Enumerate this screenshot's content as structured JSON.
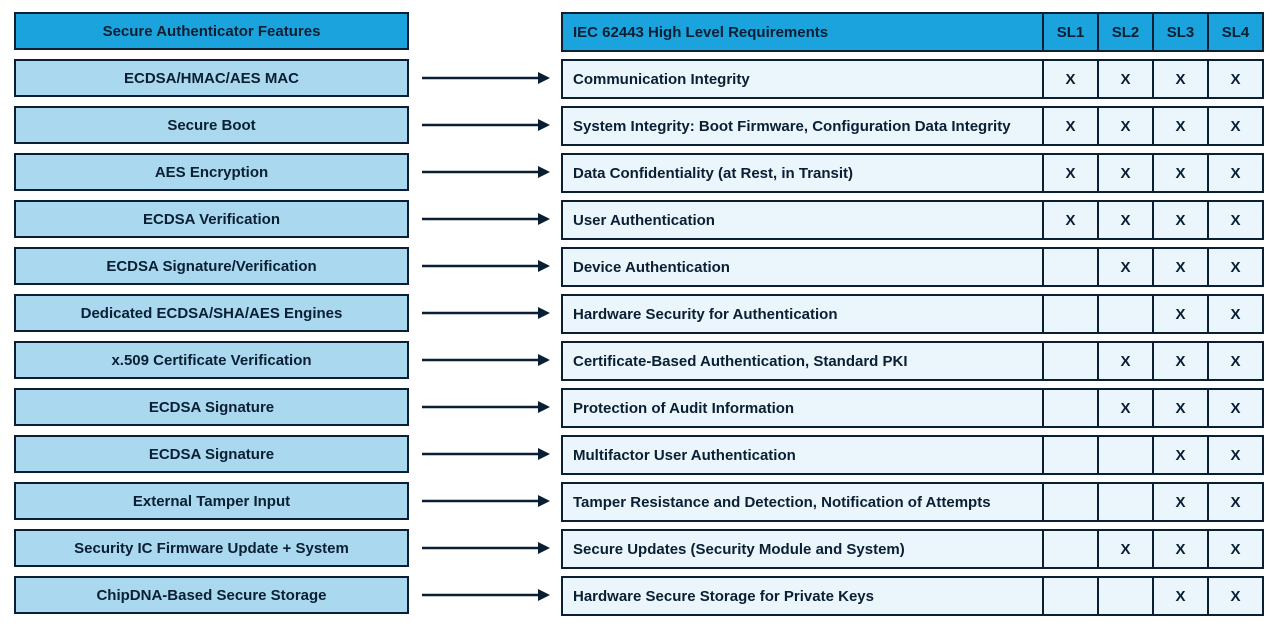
{
  "left_header": "Secure Authenticator Features",
  "right_header": "IEC 62443 High Level Requirements",
  "sl_labels": [
    "SL1",
    "SL2",
    "SL3",
    "SL4"
  ],
  "mark": "X",
  "rows": [
    {
      "feature": "ECDSA/HMAC/AES MAC",
      "requirement": "Communication Integrity",
      "sl": [
        true,
        true,
        true,
        true
      ]
    },
    {
      "feature": "Secure Boot",
      "requirement": "System Integrity: Boot Firmware, Configuration Data Integrity",
      "sl": [
        true,
        true,
        true,
        true
      ]
    },
    {
      "feature": "AES Encryption",
      "requirement": "Data Confidentiality (at Rest, in Transit)",
      "sl": [
        true,
        true,
        true,
        true
      ]
    },
    {
      "feature": "ECDSA Verification",
      "requirement": "User Authentication",
      "sl": [
        true,
        true,
        true,
        true
      ]
    },
    {
      "feature": "ECDSA Signature/Verification",
      "requirement": "Device Authentication",
      "sl": [
        false,
        true,
        true,
        true
      ]
    },
    {
      "feature": "Dedicated ECDSA/SHA/AES Engines",
      "requirement": "Hardware Security for Authentication",
      "sl": [
        false,
        false,
        true,
        true
      ]
    },
    {
      "feature": "x.509 Certificate Verification",
      "requirement": "Certificate-Based Authentication, Standard PKI",
      "sl": [
        false,
        true,
        true,
        true
      ]
    },
    {
      "feature": "ECDSA Signature",
      "requirement": "Protection of Audit Information",
      "sl": [
        false,
        true,
        true,
        true
      ]
    },
    {
      "feature": "ECDSA Signature",
      "requirement": "Multifactor User Authentication",
      "sl": [
        false,
        false,
        true,
        true
      ]
    },
    {
      "feature": "External Tamper Input",
      "requirement": "Tamper Resistance and Detection, Notification of Attempts",
      "sl": [
        false,
        false,
        true,
        true
      ]
    },
    {
      "feature": "Security IC Firmware Update + System",
      "requirement": "Secure Updates (Security Module and System)",
      "sl": [
        false,
        true,
        true,
        true
      ]
    },
    {
      "feature": "ChipDNA-Based Secure Storage",
      "requirement": "Hardware Secure Storage for Private Keys",
      "sl": [
        false,
        false,
        true,
        true
      ]
    }
  ]
}
